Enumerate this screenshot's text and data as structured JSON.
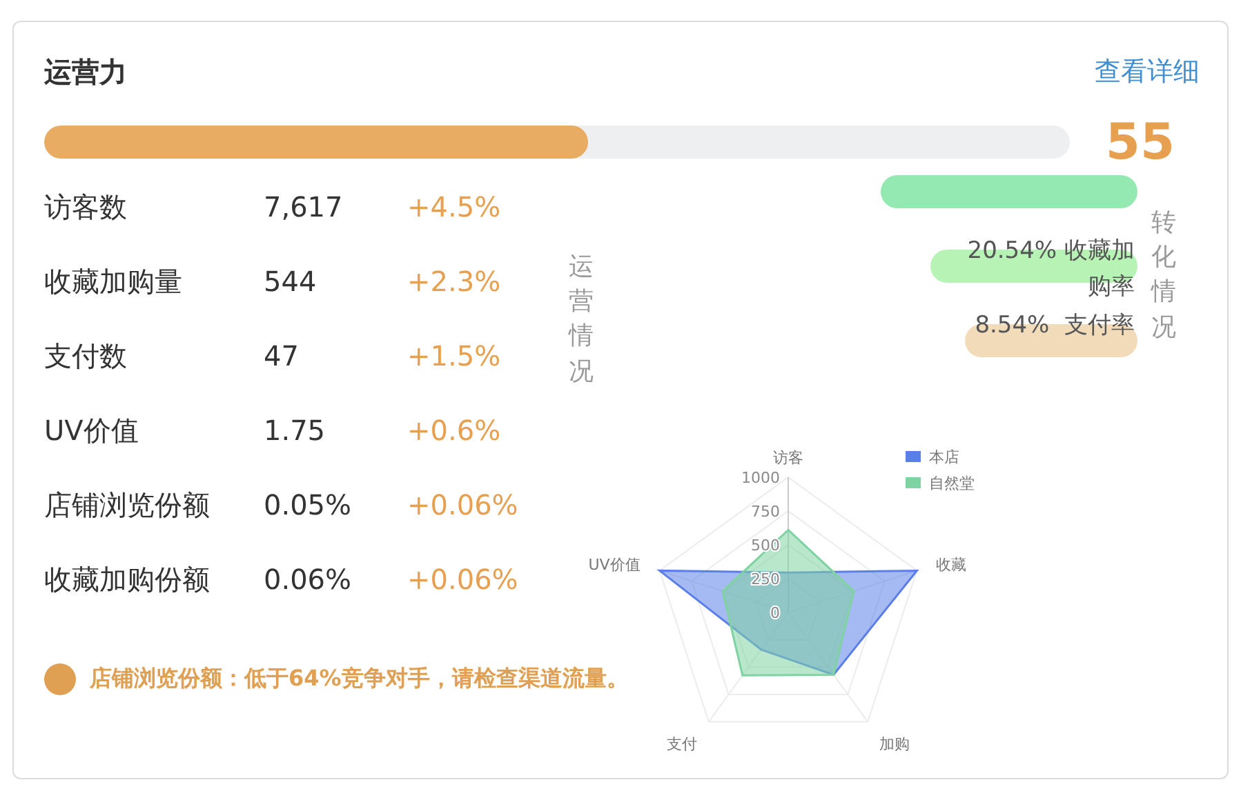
{
  "header": {
    "title": "运营力",
    "link": "查看详细"
  },
  "progress": {
    "level": 0.53,
    "score": "55"
  },
  "metrics": [
    {
      "label": "访客数",
      "value": "7,617",
      "change": "+4.5%"
    },
    {
      "label": "收藏加购量",
      "value": "544",
      "change": "+2.3%"
    },
    {
      "label": "支付数",
      "value": "47",
      "change": "+1.5%"
    },
    {
      "label": "UV价值",
      "value": "1.75",
      "change": "+0.6%"
    },
    {
      "label": "店铺浏览份额",
      "value": "0.05%",
      "change": "+0.06%"
    },
    {
      "label": "收藏加购份额",
      "value": "0.06%",
      "change": "+0.06%"
    }
  ],
  "section_label": "运营情况",
  "funnel": {
    "label": "转化情况",
    "items": [
      {
        "color": "#93e9b0"
      },
      {
        "text": "20.54% 收藏加购率",
        "color": "#b8f3b6"
      },
      {
        "text": "8.54%  支付率",
        "color": "#f2dbb9"
      }
    ]
  },
  "tip": "店铺浏览份额：低于64%竞争对手，请检查渠道流量。",
  "chart": {
    "chart_data": {
      "type": "radar",
      "categories": [
        "访客",
        "收藏",
        "加购",
        "支付",
        "UV价值"
      ],
      "series": [
        {
          "name": "本店",
          "color": "#5b7fe8",
          "values": [
            295,
            1000,
            570,
            340,
            1000
          ]
        },
        {
          "name": "自然堂",
          "color": "#7fd3a3",
          "values": [
            610,
            510,
            570,
            575,
            510
          ]
        }
      ],
      "legend": true,
      "ylim": [
        0,
        1000
      ],
      "yticks": [
        0,
        250,
        500,
        750,
        1000
      ]
    }
  }
}
